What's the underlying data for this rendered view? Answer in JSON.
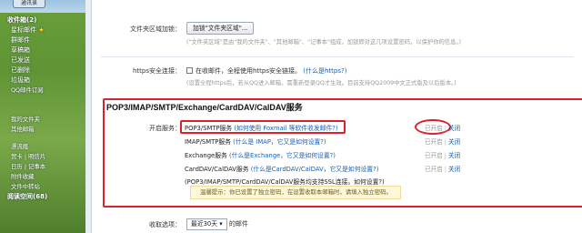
{
  "sidebar": {
    "top_button": "通讯录",
    "folders_head": "收件箱(2)",
    "items": [
      {
        "label": "星标邮件",
        "star": "★"
      },
      {
        "label": "群邮件"
      },
      {
        "label": "草稿箱"
      },
      {
        "label": "已发送"
      },
      {
        "label": "已删除"
      },
      {
        "label": "垃圾箱"
      },
      {
        "label": "QQ邮件订阅"
      }
    ],
    "my_folders": "我的文件夹",
    "other_mail": "其他邮箱",
    "bottom_items": [
      {
        "label": "漂流瓶"
      },
      {
        "label": "贺卡 | 明信片"
      },
      {
        "label": "日历 | 记事本"
      },
      {
        "label": "附件收藏"
      },
      {
        "label": "文件中转站"
      },
      {
        "label": "阅读空间(68)"
      }
    ]
  },
  "settings": {
    "folder_lock": {
      "label": "文件夹区域加锁：",
      "button": "加锁\"文件夹区域\"...",
      "hint": "(\"文件夹区域\"是由\"我的文件夹\"、\"其他邮箱\"、\"记事本\"组成，加锁即对这几项设置密码，以保护你的信息。)"
    },
    "https": {
      "label": "https安全连接：",
      "checkbox_text": "在收邮件，全程使用https安全链接。",
      "link": "(什么是https?)",
      "hint": "(设置全程https后，若从QQ进入邮箱，需重新登录QQ才生效。目前支持QQ2009中文正式版及以后版本。)"
    }
  },
  "pop_section": {
    "title": "POP3/IMAP/SMTP/Exchange/CardDAV/CalDAV服务",
    "enable_label": "开启服务：",
    "services": [
      {
        "name": "POP3/SMTP服务",
        "note": "(如何使用 Foxmail 等软件收发邮件?)",
        "status": "已开启",
        "action": "关闭"
      },
      {
        "name": "IMAP/SMTP服务",
        "note": "(什么是 IMAP，它又是如何设置?)",
        "status": "已开启",
        "action": "关闭"
      },
      {
        "name": "Exchange服务",
        "note": "(什么是Exchange，它又是如何设置?)",
        "status": "已开启",
        "action": "关闭"
      },
      {
        "name": "CardDAV/CalDAV服务",
        "note": "(什么是CardDAV/CalDAV，它又是如何设置?)",
        "status": "已开启",
        "action": "关闭"
      }
    ],
    "ssl_note": "(POP3/IMAP/SMTP/CardDAV/CalDAV服务均支持SSL连接。如何设置?)",
    "warning": "温馨提示：你已设置了独立密码，在设置收取本邮箱时，请填入独立密码。"
  },
  "fetch": {
    "label": "收取选项：",
    "select_value": "最近30天",
    "suffix": "的邮件"
  }
}
